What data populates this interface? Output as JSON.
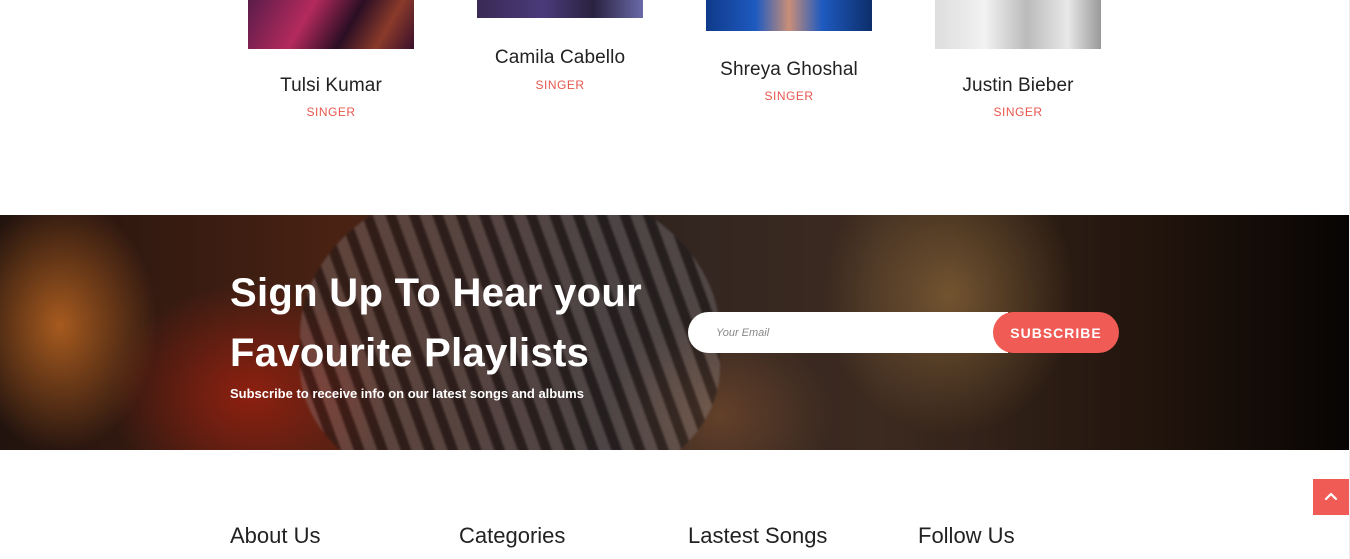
{
  "artists": [
    {
      "name": "Tulsi Kumar",
      "role": "SINGER"
    },
    {
      "name": "Camila Cabello",
      "role": "SINGER"
    },
    {
      "name": "Shreya Ghoshal",
      "role": "SINGER"
    },
    {
      "name": "Justin Bieber",
      "role": "SINGER"
    }
  ],
  "newsletter": {
    "title": "Sign Up To Hear your Favourite Playlists",
    "subtitle": "Subscribe to receive info on our latest songs and albums",
    "email_placeholder": "Your Email",
    "subscribe_label": "SUBSCRIBE"
  },
  "footer": {
    "columns": [
      "About Us",
      "Categories",
      "Lastest Songs",
      "Follow Us"
    ]
  },
  "colors": {
    "accent": "#f05b55",
    "role_text": "#e8574e"
  },
  "icons": {
    "back_to_top": "chevron-up-icon"
  }
}
